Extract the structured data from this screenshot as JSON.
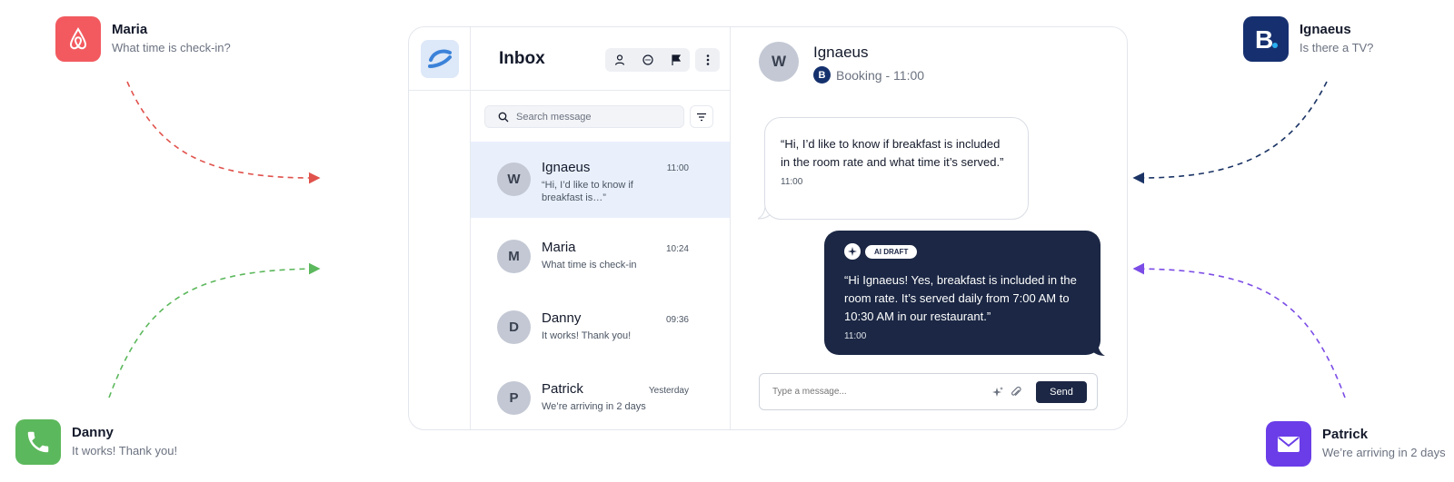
{
  "sources": [
    {
      "id": "airbnb",
      "channel_icon": "airbnb-icon",
      "name": "Maria",
      "message": "What time is check-in?",
      "color": "#f25a5f"
    },
    {
      "id": "booking",
      "channel_icon": "booking-icon",
      "name": "Ignaeus",
      "message": "Is there a TV?",
      "color": "#16306f"
    },
    {
      "id": "phone",
      "channel_icon": "phone-icon",
      "name": "Danny",
      "message": "It works! Thank you!",
      "color": "#5cb85c"
    },
    {
      "id": "email",
      "channel_icon": "mail-icon",
      "name": "Patrick",
      "message": "We’re arriving in 2 days",
      "color": "#6a3de8"
    }
  ],
  "colors": {
    "arrow_red": "#e0524c",
    "arrow_navy": "#1b3465",
    "arrow_green": "#5cb85c",
    "arrow_purple": "#7b4ce6",
    "navy": "#1b2744",
    "active_row": "#e9f0fc"
  },
  "inbox": {
    "title": "Inbox",
    "tools": [
      "person-icon",
      "chat-icon",
      "flag-icon",
      "more-icon"
    ],
    "search": {
      "placeholder": "Search message"
    },
    "conversations": [
      {
        "initial": "W",
        "name": "Ignaeus",
        "time": "11:00",
        "preview": "“Hi, I’d like to know if breakfast is…”",
        "active": true
      },
      {
        "initial": "M",
        "name": "Maria",
        "time": "10:24",
        "preview": "What time is check-in"
      },
      {
        "initial": "D",
        "name": "Danny",
        "time": "09:36",
        "preview": "It works! Thank you!"
      },
      {
        "initial": "P",
        "name": "Patrick",
        "time": "Yesterday",
        "preview": "We’re arriving in 2 days"
      }
    ]
  },
  "chat": {
    "initial": "W",
    "name": "Ignaeus",
    "source_badge": "B",
    "source": "Booking - 11:00",
    "incoming": {
      "text": "“Hi, I’d like to know if breakfast is included in the room rate and what time it’s served.”",
      "time": "11:00"
    },
    "draft": {
      "label": "AI DRAFT",
      "text": "“Hi Ignaeus! Yes, breakfast is included in the room rate. It’s served daily from 7:00 AM to 10:30 AM in our restaurant.”",
      "time": "11:00"
    },
    "composer": {
      "placeholder": "Type a message...",
      "send_label": "Send"
    }
  }
}
